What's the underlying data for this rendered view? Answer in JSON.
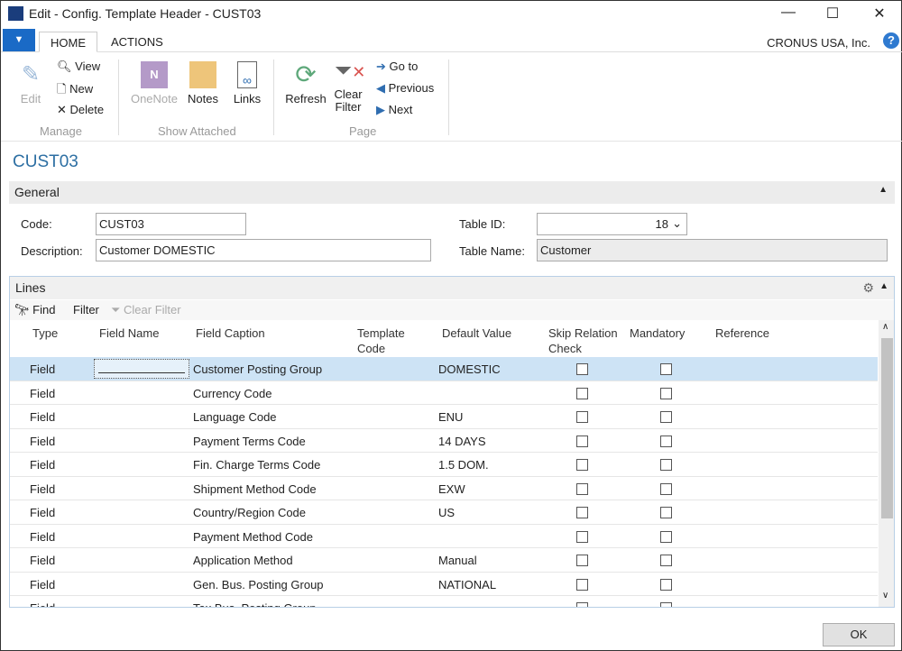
{
  "window": {
    "title": "Edit - Config. Template Header - CUST03",
    "minimize": "—",
    "maximize": "☐",
    "close": "✕"
  },
  "tabs": [
    {
      "label": "HOME"
    },
    {
      "label": "ACTIONS"
    }
  ],
  "menu_icon": "▼",
  "company": "CRONUS USA, Inc.",
  "help": "?",
  "ribbon": {
    "manage": {
      "edit": "Edit",
      "view": "View",
      "new": "New",
      "delete": "Delete",
      "group": "Manage"
    },
    "show_attached": {
      "onenote": "OneNote",
      "notes": "Notes",
      "links": "Links",
      "group": "Show Attached"
    },
    "page": {
      "refresh": "Refresh",
      "clear_filter_1": "Clear",
      "clear_filter_2": "Filter",
      "goto": "Go to",
      "previous": "Previous",
      "next": "Next",
      "group": "Page"
    }
  },
  "page_title": "CUST03",
  "general": {
    "title": "General",
    "code_label": "Code:",
    "code": "CUST03",
    "desc_label": "Description:",
    "desc": "Customer DOMESTIC",
    "table_id_label": "Table ID:",
    "table_id": "18",
    "table_name_label": "Table Name:",
    "table_name": "Customer"
  },
  "lines": {
    "title": "Lines",
    "find": "Find",
    "filter": "Filter",
    "clear_filter": "Clear Filter",
    "columns": [
      "Type",
      "Field Name",
      "Field Caption",
      "Template\nCode",
      "Default Value",
      "Skip Relation\nCheck",
      "Mandatory",
      "Reference"
    ],
    "rows": [
      {
        "type": "Field",
        "field_name": "",
        "caption": "Customer Posting Group",
        "template_code": "",
        "default": "DOMESTIC",
        "skip": false,
        "mandatory": false,
        "reference": ""
      },
      {
        "type": "Field",
        "field_name": "",
        "caption": "Currency Code",
        "template_code": "",
        "default": "",
        "skip": false,
        "mandatory": false,
        "reference": ""
      },
      {
        "type": "Field",
        "field_name": "",
        "caption": "Language Code",
        "template_code": "",
        "default": "ENU",
        "skip": false,
        "mandatory": false,
        "reference": ""
      },
      {
        "type": "Field",
        "field_name": "",
        "caption": "Payment Terms Code",
        "template_code": "",
        "default": "14 DAYS",
        "skip": false,
        "mandatory": false,
        "reference": ""
      },
      {
        "type": "Field",
        "field_name": "",
        "caption": "Fin. Charge Terms Code",
        "template_code": "",
        "default": "1.5 DOM.",
        "skip": false,
        "mandatory": false,
        "reference": ""
      },
      {
        "type": "Field",
        "field_name": "",
        "caption": "Shipment Method Code",
        "template_code": "",
        "default": "EXW",
        "skip": false,
        "mandatory": false,
        "reference": ""
      },
      {
        "type": "Field",
        "field_name": "",
        "caption": "Country/Region Code",
        "template_code": "",
        "default": "US",
        "skip": false,
        "mandatory": false,
        "reference": ""
      },
      {
        "type": "Field",
        "field_name": "",
        "caption": "Payment Method Code",
        "template_code": "",
        "default": "",
        "skip": false,
        "mandatory": false,
        "reference": ""
      },
      {
        "type": "Field",
        "field_name": "",
        "caption": "Application Method",
        "template_code": "",
        "default": "Manual",
        "skip": false,
        "mandatory": false,
        "reference": ""
      },
      {
        "type": "Field",
        "field_name": "",
        "caption": "Gen. Bus. Posting Group",
        "template_code": "",
        "default": "NATIONAL",
        "skip": false,
        "mandatory": false,
        "reference": ""
      },
      {
        "type": "Field",
        "field_name": "",
        "caption": "Tax Bus. Posting Group",
        "template_code": "",
        "default": "",
        "skip": false,
        "mandatory": false,
        "reference": ""
      }
    ]
  },
  "ok": "OK",
  "colors": {
    "accent": "#1a6ac6",
    "title": "#2d6fa3",
    "selected_row": "#cde3f5"
  }
}
